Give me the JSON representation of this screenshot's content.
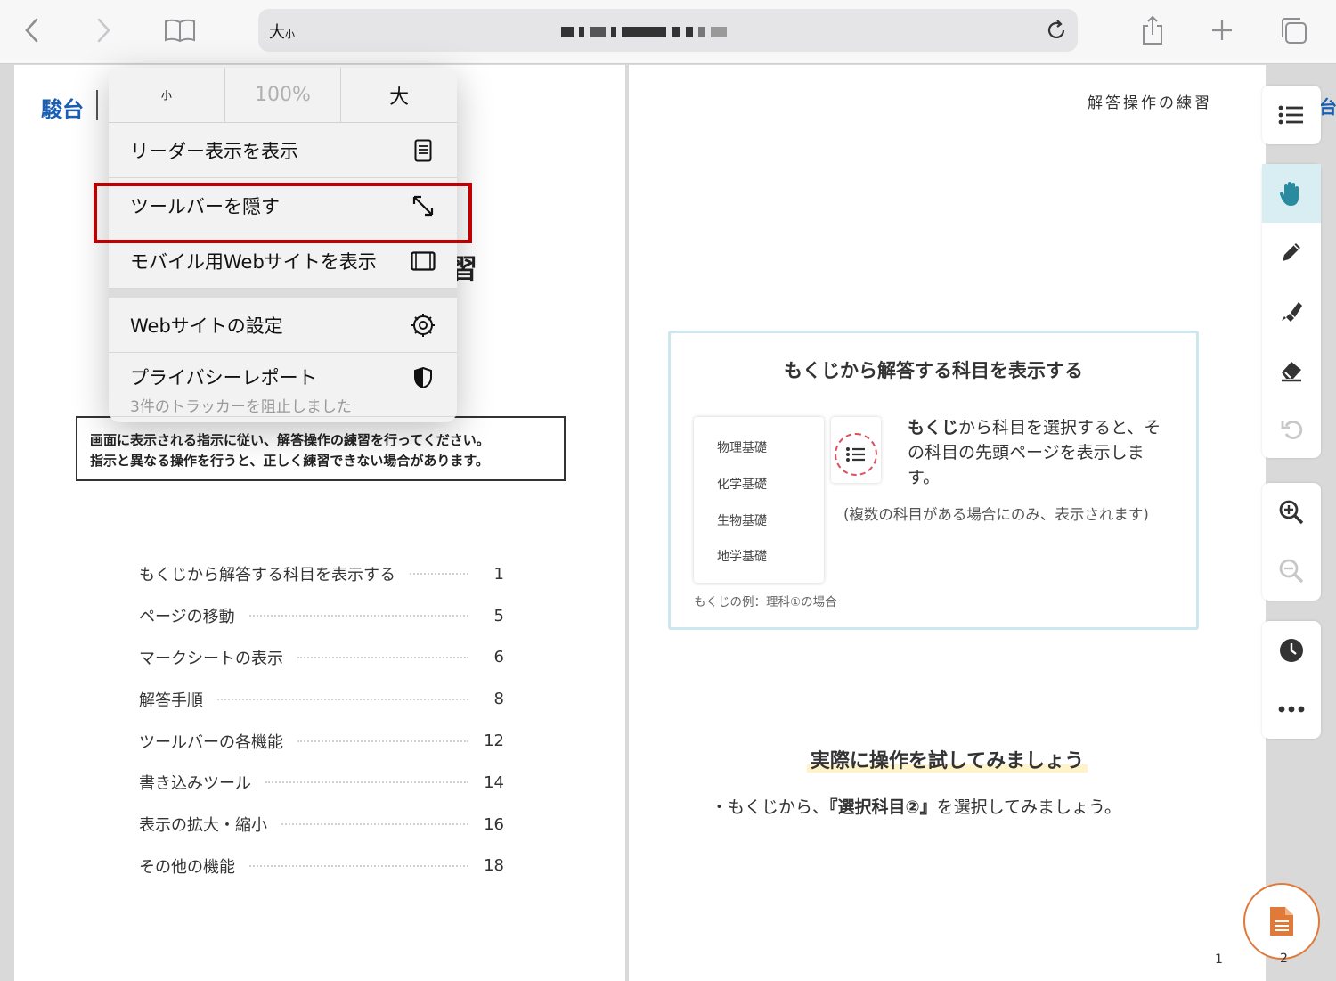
{
  "toolbar": {
    "text_size_label_large": "大",
    "text_size_label_small": "小"
  },
  "left_page": {
    "logo": "駿台",
    "partial_heading_char": "習",
    "notice_line1": "画面に表示される指示に従い、解答操作の練習を行ってください。",
    "notice_line2": "指示と異なる操作を行うと、正しく練習できない場合があります。",
    "toc": [
      {
        "label": "もくじから解答する科目を表示する",
        "page": "1"
      },
      {
        "label": "ページの移動",
        "page": "5"
      },
      {
        "label": "マークシートの表示",
        "page": "6"
      },
      {
        "label": "解答手順",
        "page": "8"
      },
      {
        "label": "ツールバーの各機能",
        "page": "12"
      },
      {
        "label": "書き込みツール",
        "page": "14"
      },
      {
        "label": "表示の拡大・縮小",
        "page": "16"
      },
      {
        "label": "その他の機能",
        "page": "18"
      }
    ]
  },
  "right_page": {
    "header": "解答操作の練習",
    "card_title": "もくじから解答する科目を表示する",
    "subjects": [
      "物理基礎",
      "化学基礎",
      "生物基礎",
      "地学基礎"
    ],
    "example_caption": "もくじの例：理科①の場合",
    "desc_bold": "もくじ",
    "desc_rest": "から科目を選択すると、その科目の先頭ページを表示します。",
    "note": "(複数の科目がある場合にのみ、表示されます)",
    "try_title": "実際に操作を試してみましょう",
    "try_desc_pre": "・もくじから、",
    "try_desc_bold": "『選択科目②』",
    "try_desc_post": "を選択してみましょう。",
    "page_number": "1"
  },
  "side_panel": {
    "edge_text": "台",
    "fab_page": "2"
  },
  "popover": {
    "zoom_small": "小",
    "zoom_percent": "100%",
    "zoom_large": "大",
    "items": [
      {
        "label": "リーダー表示を表示",
        "icon": "reader-icon"
      },
      {
        "label": "ツールバーを隠す",
        "icon": "resize-arrows-icon"
      },
      {
        "label": "モバイル用Webサイトを表示",
        "icon": "mobile-frame-icon"
      },
      {
        "label": "Webサイトの設定",
        "icon": "gear-icon"
      },
      {
        "label": "プライバシーレポート",
        "sub": "3件のトラッカーを阻止しました",
        "icon": "shield-icon"
      }
    ]
  },
  "colors": {
    "highlight": "#c00000",
    "accent_teal": "#2a8ba0",
    "fab_border": "#e07a3a",
    "logo_blue": "#1a5fb4"
  }
}
